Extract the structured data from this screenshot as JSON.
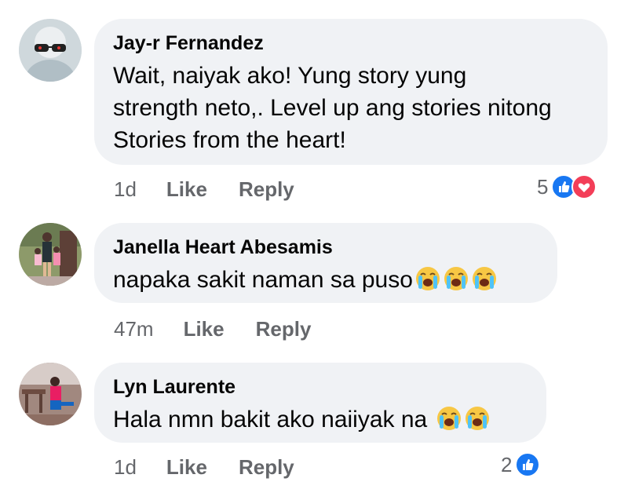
{
  "comments": [
    {
      "author": "Jay-r Fernandez",
      "text_lines": [
        "Wait, naiyak ako! Yung story yung",
        "strength neto,. Level up ang stories nitong",
        "Stories from the heart!"
      ],
      "time": "1d",
      "like_label": "Like",
      "reply_label": "Reply",
      "reaction_count": "5",
      "reactions": [
        "like-icon",
        "love-icon"
      ],
      "avatar": "avatar-jayr"
    },
    {
      "author": "Janella Heart Abesamis",
      "text": "napaka sakit naman sa puso",
      "emoji_count": 3,
      "emoji": "loudly-crying-face",
      "time": "47m",
      "like_label": "Like",
      "reply_label": "Reply",
      "avatar": "avatar-janella"
    },
    {
      "author": "Lyn Laurente",
      "text": "Hala nmn bakit ako naiiyak na ",
      "emoji_count": 2,
      "emoji": "loudly-crying-face",
      "time": "1d",
      "like_label": "Like",
      "reply_label": "Reply",
      "reaction_count": "2",
      "reactions": [
        "like-icon"
      ],
      "avatar": "avatar-lyn"
    }
  ],
  "colors": {
    "bubble": "#f0f2f5",
    "meta": "#65676b",
    "like": "#1877f2",
    "love": "#f33e58",
    "emoji_face": "#f7c744"
  }
}
